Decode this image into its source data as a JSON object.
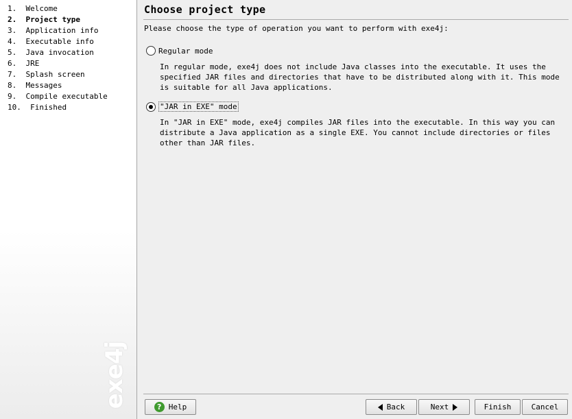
{
  "sidebar": {
    "steps": [
      "1.  Welcome",
      "2.  Project type",
      "3.  Application info",
      "4.  Executable info",
      "5.  Java invocation",
      "6.  JRE",
      "7.  Splash screen",
      "8.  Messages",
      "9.  Compile executable",
      "10.  Finished"
    ],
    "current_step_index": 1,
    "watermark": "exe4j"
  },
  "main": {
    "title": "Choose project type",
    "prompt": "Please choose the type of operation you want to perform with exe4j:",
    "options": [
      {
        "label": "Regular mode",
        "checked": false,
        "description": "In regular mode, exe4j does not include Java classes into the executable. It uses the specified JAR files and directories that have to be distributed along with it. This mode is suitable for all Java applications."
      },
      {
        "label": "\"JAR in EXE\" mode",
        "checked": true,
        "description": "In \"JAR in EXE\" mode, exe4j compiles JAR files into the executable. In this way you can distribute a Java application as a single EXE. You cannot include directories or files other than JAR files."
      }
    ]
  },
  "buttons": {
    "help": "Help",
    "back": "Back",
    "next": "Next",
    "finish": "Finish",
    "cancel": "Cancel"
  }
}
